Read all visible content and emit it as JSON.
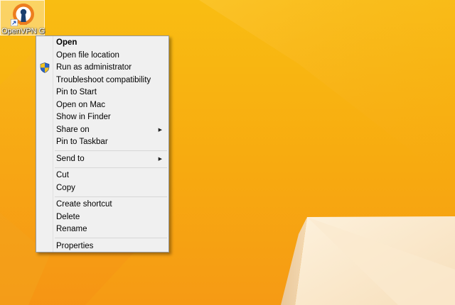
{
  "desktop": {
    "icon": {
      "label": "OpenVPN GUI",
      "icon_name": "openvpn-icon",
      "shortcut_overlay": "shortcut-arrow-icon"
    }
  },
  "colors": {
    "background": "#f8b414",
    "accent_orange": "#ed7d1e",
    "menu_bg": "#f0f0f0"
  },
  "context_menu": {
    "group1": [
      {
        "label": "Open",
        "bold": true
      },
      {
        "label": "Open file location"
      },
      {
        "label": "Run as administrator",
        "icon": "uac-shield-icon"
      },
      {
        "label": "Troubleshoot compatibility"
      },
      {
        "label": "Pin to Start"
      },
      {
        "label": "Open on Mac"
      },
      {
        "label": "Show in Finder"
      },
      {
        "label": "Share on",
        "submenu": true
      },
      {
        "label": "Pin to Taskbar"
      }
    ],
    "group2": [
      {
        "label": "Send to",
        "submenu": true
      }
    ],
    "group3": [
      {
        "label": "Cut"
      },
      {
        "label": "Copy"
      }
    ],
    "group4": [
      {
        "label": "Create shortcut"
      },
      {
        "label": "Delete"
      },
      {
        "label": "Rename"
      }
    ],
    "group5": [
      {
        "label": "Properties"
      }
    ]
  }
}
